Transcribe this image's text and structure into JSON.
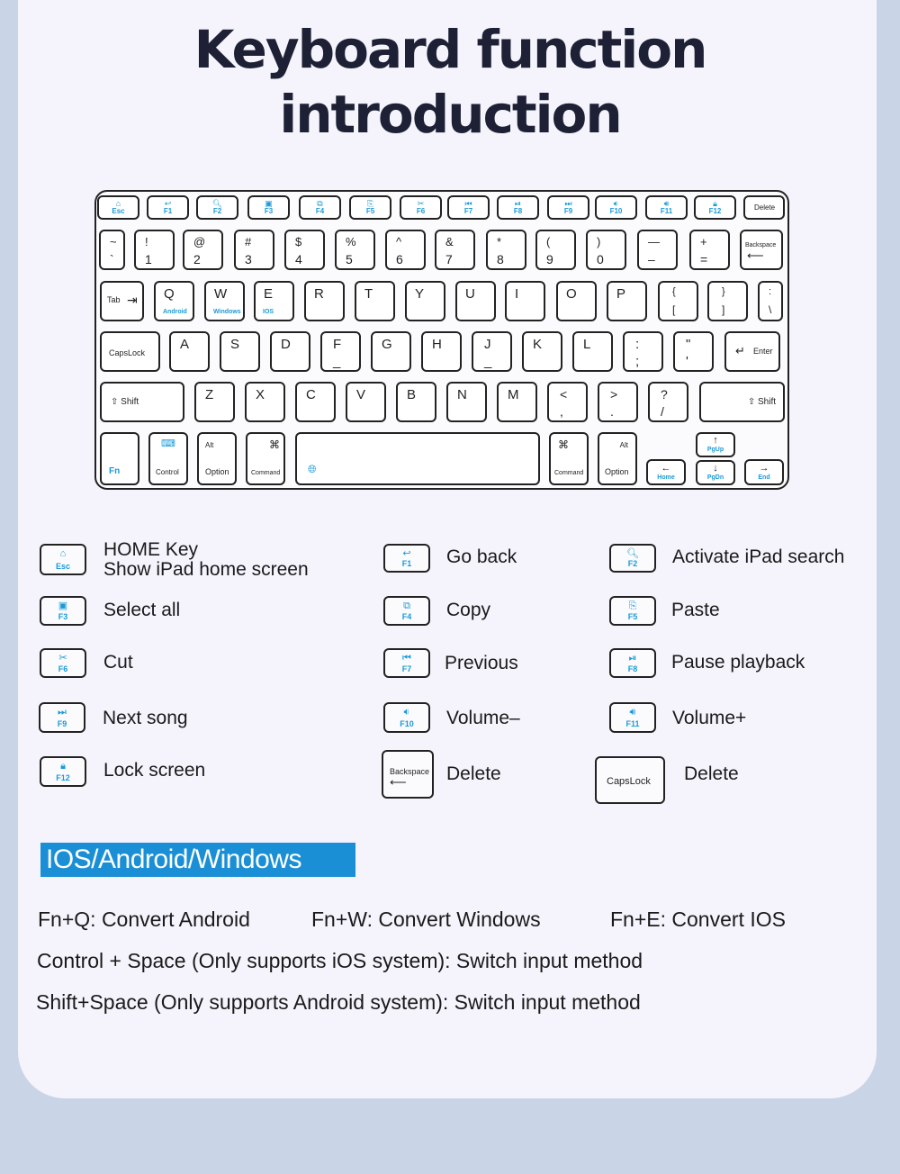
{
  "title": {
    "line1": "Keyboard function",
    "line2": "introduction"
  },
  "colors": {
    "accent": "#1a9ad6",
    "badge": "#1a8fd6",
    "background": "#c9d4e6",
    "card": "#f5f4fd",
    "title": "#1e2135"
  },
  "keyboard": {
    "fn_row": [
      {
        "icon": "home-icon",
        "glyph": "⌂",
        "label": "Esc"
      },
      {
        "icon": "back-icon",
        "glyph": "↩",
        "label": "F1"
      },
      {
        "icon": "search-icon",
        "glyph": "🔍︎",
        "label": "F2"
      },
      {
        "icon": "select-all-icon",
        "glyph": "▣",
        "label": "F3"
      },
      {
        "icon": "copy-icon",
        "glyph": "⧉",
        "label": "F4"
      },
      {
        "icon": "paste-icon",
        "glyph": "⎘",
        "label": "F5"
      },
      {
        "icon": "cut-icon",
        "glyph": "✂",
        "label": "F6"
      },
      {
        "icon": "previous-icon",
        "glyph": "⏮",
        "label": "F7"
      },
      {
        "icon": "play-pause-icon",
        "glyph": "⏯",
        "label": "F8"
      },
      {
        "icon": "next-icon",
        "glyph": "⏭",
        "label": "F9"
      },
      {
        "icon": "volume-down-icon",
        "glyph": "🔉︎",
        "label": "F10"
      },
      {
        "icon": "volume-up-icon",
        "glyph": "🔊︎",
        "label": "F11"
      },
      {
        "icon": "lock-icon",
        "glyph": "🔒︎",
        "label": "F12"
      },
      {
        "icon": "",
        "glyph": "",
        "label": "Delete"
      }
    ],
    "number_row": [
      {
        "top": "~",
        "bottom": "`"
      },
      {
        "top": "!",
        "bottom": "1"
      },
      {
        "top": "@",
        "bottom": "2"
      },
      {
        "top": "#",
        "bottom": "3"
      },
      {
        "top": "$",
        "bottom": "4"
      },
      {
        "top": "%",
        "bottom": "5"
      },
      {
        "top": "^",
        "bottom": "6"
      },
      {
        "top": "&",
        "bottom": "7"
      },
      {
        "top": "*",
        "bottom": "8"
      },
      {
        "top": "(",
        "bottom": "9"
      },
      {
        "top": ")",
        "bottom": "0"
      },
      {
        "top": "—",
        "bottom": "–"
      },
      {
        "top": "+",
        "bottom": "="
      },
      {
        "top": "Backspace",
        "bottom": "⟵"
      }
    ],
    "q_row": [
      {
        "top": "Tab",
        "bottom": "⇥"
      },
      {
        "top": "Q",
        "sub": "Android"
      },
      {
        "top": "W",
        "sub": "Windows"
      },
      {
        "top": "E",
        "sub": "IOS"
      },
      {
        "top": "R"
      },
      {
        "top": "T"
      },
      {
        "top": "Y"
      },
      {
        "top": "U"
      },
      {
        "top": "I"
      },
      {
        "top": "O"
      },
      {
        "top": "P"
      },
      {
        "top": "{",
        "bottom": "["
      },
      {
        "top": "}",
        "bottom": "]"
      },
      {
        "top": ":",
        "bottom": "\\"
      }
    ],
    "a_row": [
      {
        "top": "CapsLock"
      },
      {
        "top": "A"
      },
      {
        "top": "S"
      },
      {
        "top": "D"
      },
      {
        "top": "F",
        "bottom": "_"
      },
      {
        "top": "G"
      },
      {
        "top": "H"
      },
      {
        "top": "J",
        "bottom": "_"
      },
      {
        "top": "K"
      },
      {
        "top": "L"
      },
      {
        "top": ":",
        "bottom": ";"
      },
      {
        "top": "\"",
        "bottom": "'"
      },
      {
        "top": "Enter",
        "bottom": "↵"
      }
    ],
    "z_row": [
      {
        "top": "⇧ Shift"
      },
      {
        "top": "Z"
      },
      {
        "top": "X"
      },
      {
        "top": "C"
      },
      {
        "top": "V"
      },
      {
        "top": "B"
      },
      {
        "top": "N"
      },
      {
        "top": "M"
      },
      {
        "top": "<",
        "bottom": ","
      },
      {
        "top": ">",
        "bottom": "."
      },
      {
        "top": "?",
        "bottom": "/"
      },
      {
        "top": "⇧ Shift"
      }
    ],
    "bottom_row": {
      "fn": "Fn",
      "control": {
        "icon": "keyboard-icon",
        "glyph": "⌨",
        "label": "Control"
      },
      "option_left": {
        "top": "Alt",
        "label": "Option"
      },
      "command_left": {
        "top": "⌘",
        "label": "Command"
      },
      "space": {
        "icon": "globe-icon",
        "glyph": "🌐︎"
      },
      "command_right": {
        "top": "⌘",
        "label": "Command"
      },
      "option_right": {
        "top": "Alt",
        "label": "Option"
      },
      "home": {
        "glyph": "←",
        "label": "Home"
      },
      "pgup": {
        "glyph": "↑",
        "label": "PgUp"
      },
      "pgdn": {
        "glyph": "↓",
        "label": "PgDn"
      },
      "end": {
        "glyph": "→",
        "label": "End"
      }
    }
  },
  "legend": [
    {
      "key_icon": "home-icon",
      "glyph": "⌂",
      "key": "Esc",
      "title": "HOME Key",
      "desc": "Show iPad home screen"
    },
    {
      "key_icon": "back-icon",
      "glyph": "↩",
      "key": "F1",
      "desc": "Go back"
    },
    {
      "key_icon": "search-icon",
      "glyph": "🔍︎",
      "key": "F2",
      "desc": "Activate iPad search"
    },
    {
      "key_icon": "select-all-icon",
      "glyph": "▣",
      "key": "F3",
      "desc": "Select all"
    },
    {
      "key_icon": "copy-icon",
      "glyph": "⧉",
      "key": "F4",
      "desc": "Copy"
    },
    {
      "key_icon": "paste-icon",
      "glyph": "⎘",
      "key": "F5",
      "desc": "Paste"
    },
    {
      "key_icon": "cut-icon",
      "glyph": "✂",
      "key": "F6",
      "desc": "Cut"
    },
    {
      "key_icon": "previous-icon",
      "glyph": "⏮",
      "key": "F7",
      "desc": "Previous"
    },
    {
      "key_icon": "play-pause-icon",
      "glyph": "⏯",
      "key": "F8",
      "desc": "Pause playback"
    },
    {
      "key_icon": "next-icon",
      "glyph": "⏭",
      "key": "F9",
      "desc": "Next song"
    },
    {
      "key_icon": "volume-down-icon",
      "glyph": "🔉︎",
      "key": "F10",
      "desc": "Volume–"
    },
    {
      "key_icon": "volume-up-icon",
      "glyph": "🔊︎",
      "key": "F11",
      "desc": "Volume+"
    },
    {
      "key_icon": "lock-icon",
      "glyph": "🔒︎",
      "key": "F12",
      "desc": "Lock screen"
    },
    {
      "key_icon": "backspace-icon",
      "glyph": "⟵",
      "key": "Backspace",
      "desc": "Delete"
    },
    {
      "key_icon": "",
      "glyph": "",
      "key": "CapsLock",
      "desc": "Delete"
    }
  ],
  "os_section": {
    "badge": "IOS/Android/Windows",
    "convert": [
      "Fn+Q: Convert Android",
      "Fn+W: Convert Windows",
      "Fn+E: Convert IOS"
    ],
    "line_control": "Control + Space (Only supports iOS system): Switch input method",
    "line_shift": "Shift+Space (Only supports Android system): Switch input method"
  }
}
